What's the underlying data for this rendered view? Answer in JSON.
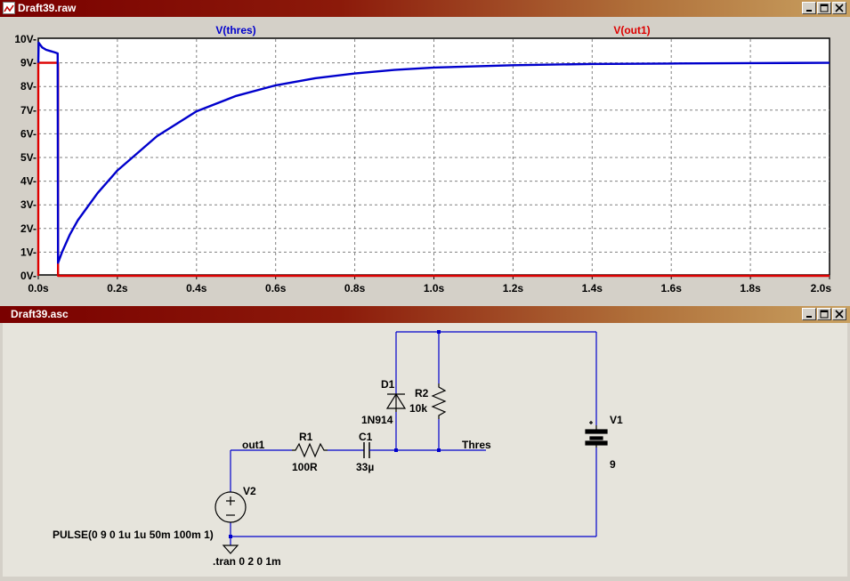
{
  "plot_window": {
    "title": "Draft39.raw",
    "trace1_label": "V(thres)",
    "trace2_label": "V(out1)",
    "trace1_color": "#0000cc",
    "trace2_color": "#dd0000"
  },
  "schematic_window": {
    "title": "Draft39.asc",
    "labels": {
      "d1_name": "D1",
      "d1_model": "1N914",
      "r2_name": "R2",
      "r2_value": "10k",
      "v1_name": "V1",
      "v1_value": "9",
      "r1_name": "R1",
      "r1_value": "100R",
      "c1_name": "C1",
      "c1_value": "33µ",
      "net_out1": "out1",
      "net_thres": "Thres",
      "v2_name": "V2",
      "v2_value": "PULSE(0 9 0 1u 1u 50m 100m 1)",
      "directive": ".tran 0 2 0 1m"
    }
  },
  "chart_data": {
    "type": "line",
    "x_unit": "s",
    "y_unit": "V",
    "xlim": [
      0,
      2.0
    ],
    "ylim": [
      0,
      10
    ],
    "x_ticks": [
      "0.0s",
      "0.2s",
      "0.4s",
      "0.6s",
      "0.8s",
      "1.0s",
      "1.2s",
      "1.4s",
      "1.6s",
      "1.8s",
      "2.0s"
    ],
    "y_ticks": [
      "0V-",
      "1V-",
      "2V-",
      "3V-",
      "4V-",
      "5V-",
      "6V-",
      "7V-",
      "8V-",
      "9V-",
      "10V-"
    ],
    "grid": true,
    "series": [
      {
        "name": "V(thres)",
        "x": [
          0.0,
          0.001,
          0.01,
          0.02,
          0.03,
          0.04,
          0.049,
          0.05,
          0.06,
          0.08,
          0.1,
          0.15,
          0.2,
          0.3,
          0.4,
          0.5,
          0.6,
          0.7,
          0.8,
          0.9,
          1.0,
          1.2,
          1.4,
          1.6,
          1.8,
          2.0
        ],
        "y": [
          9.0,
          9.85,
          9.65,
          9.55,
          9.5,
          9.45,
          9.4,
          0.55,
          1.0,
          1.75,
          2.35,
          3.5,
          4.45,
          5.9,
          6.95,
          7.6,
          8.05,
          8.35,
          8.55,
          8.7,
          8.8,
          8.9,
          8.95,
          8.97,
          8.99,
          9.0
        ]
      },
      {
        "name": "V(out1)",
        "x": [
          0.0,
          0.0,
          0.05,
          0.05,
          2.0
        ],
        "y": [
          0.0,
          9.0,
          9.0,
          0.0,
          0.0
        ]
      }
    ]
  }
}
